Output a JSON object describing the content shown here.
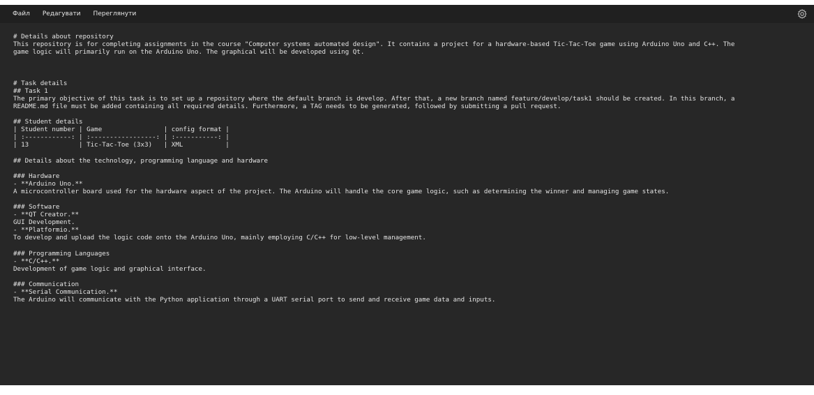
{
  "menu": {
    "items": [
      "Файл",
      "Редагувати",
      "Переглянути"
    ]
  },
  "icons": {
    "settings": "gear-icon"
  },
  "editor": {
    "lines": [
      "# Details about repository",
      "This repository is for completing assignments in the course \"Computer systems automated design\". It contains a project for a hardware-based Tic-Tac-Toe game using Arduino Uno and C++. The",
      "game logic will primarily run on the Arduino Uno. The graphical will be developed using Qt.",
      "",
      "",
      "",
      "# Task details",
      "## Task 1",
      "The primary objective of this task is to set up a repository where the default branch is develop. After that, a new branch named feature/develop/task1 should be created. In this branch, a",
      "README.md file must be added containing all required details. Furthermore, a TAG needs to be generated, followed by submitting a pull request.",
      "",
      "## Student details",
      "| Student number | Game                | config format |",
      "| :------------: | :-----------------: | :-----------: |",
      "| 13             | Tic-Tac-Toe (3x3)   | XML           |",
      "",
      "## Details about the technology, programming language and hardware",
      "",
      "### Hardware",
      "- **Arduino Uno.**",
      "A microcontroller board used for the hardware aspect of the project. The Arduino will handle the core game logic, such as determining the winner and managing game states.",
      "",
      "### Software",
      "- **QT Creator.**",
      "GUI Development.",
      "- **Platformio.**",
      "To develop and upload the logic code onto the Arduino Uno, mainly employing C/C++ for low-level management.",
      "",
      "### Programming Languages",
      "- **C/C++.**",
      "Development of game logic and graphical interface.",
      "",
      "### Communication",
      "- **Serial Communication.**",
      "The Arduino will communicate with the Python application through a UART serial port to send and receive game data and inputs."
    ]
  }
}
